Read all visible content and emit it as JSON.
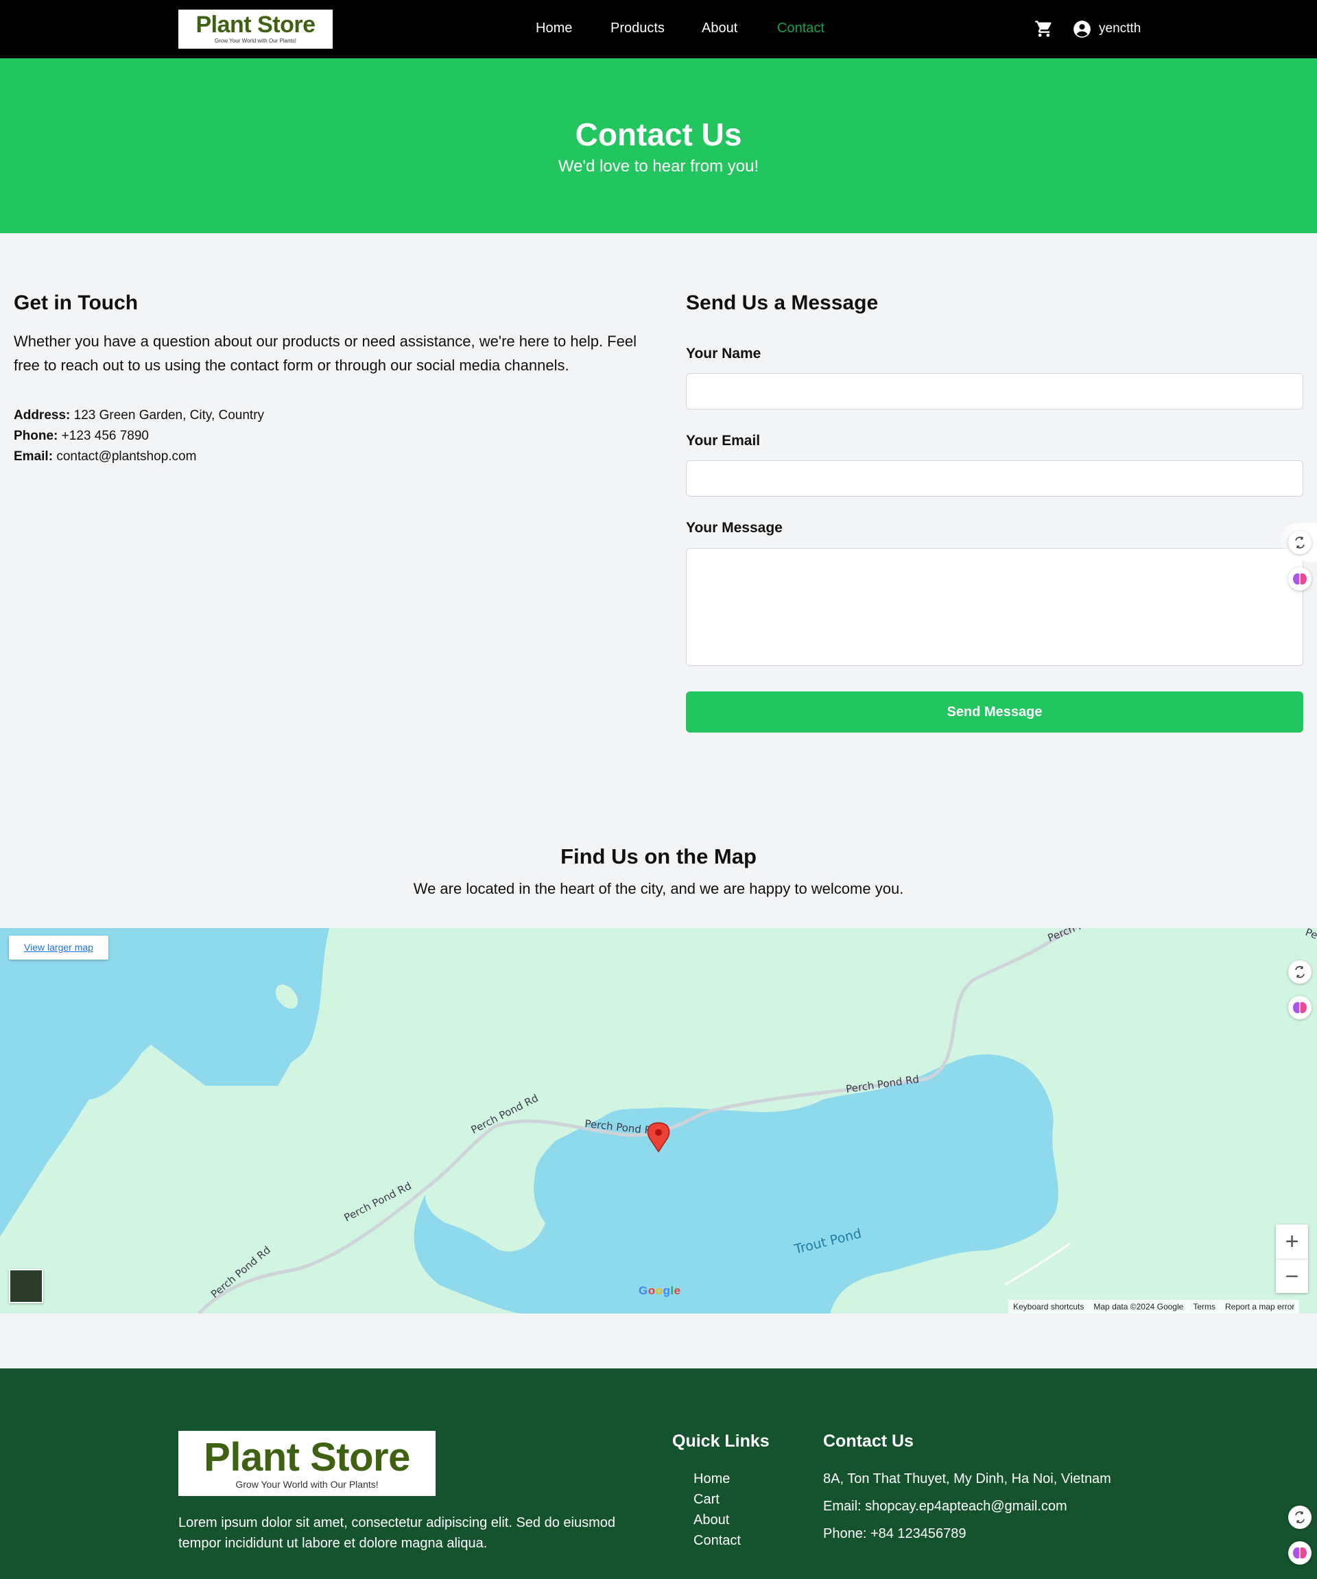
{
  "header": {
    "logo_title": "Plant Store",
    "logo_tagline": "Grow Your World with Our Plants!",
    "nav": [
      {
        "label": "Home"
      },
      {
        "label": "Products"
      },
      {
        "label": "About"
      },
      {
        "label": "Contact",
        "active": true
      }
    ],
    "username": "yenctth",
    "active_color": "#16a34a"
  },
  "hero": {
    "title": "Contact Us",
    "subtitle": "We'd love to hear from you!",
    "color": "#22c55e"
  },
  "touch": {
    "title": "Get in Touch",
    "text": "Whether you have a question about our products or need assistance, we're here to help. Feel free to reach out to us using the contact form or through our social media channels.",
    "address_label": "Address:",
    "address": "123 Green Garden, City, Country",
    "phone_label": "Phone:",
    "phone": "+123 456 7890",
    "email_label": "Email:",
    "email": "contact@plantshop.com"
  },
  "form": {
    "title": "Send Us a Message",
    "name_label": "Your Name",
    "name_value": "",
    "email_label": "Your Email",
    "email_value": "",
    "message_label": "Your Message",
    "message_value": "",
    "submit_label": "Send Message"
  },
  "map_section": {
    "title": "Find Us on the Map",
    "subtitle": "We are located in the heart of the city, and we are happy to welcome you.",
    "larger_map_link": "View larger map",
    "road_labels": [
      "Perch Pond Rd",
      "Perch Pond Rd",
      "Perch Pond Rd",
      "Perch Pond Rd",
      "Perch Pond Rd",
      "Perch P..",
      "Pe"
    ],
    "water_label": "Trout Pond",
    "google_logo": "Google",
    "attribution": [
      "Keyboard shortcuts",
      "Map data ©2024 Google",
      "Terms",
      "Report a map error"
    ],
    "zoom_in": "+",
    "zoom_out": "−"
  },
  "footer": {
    "logo_title": "Plant Store",
    "logo_tagline": "Grow Your World with Our Plants!",
    "description": "Lorem ipsum dolor sit amet, consectetur adipiscing elit. Sed do eiusmod tempor incididunt ut labore et dolore magna aliqua.",
    "quick_links_title": "Quick Links",
    "quick_links": [
      "Home",
      "Cart",
      "About",
      "Contact"
    ],
    "contact_title": "Contact Us",
    "contact_address": "8A, Ton That Thuyet, My Dinh, Ha Noi, Vietnam",
    "contact_email": "Email: shopcay.ep4apteach@gmail.com",
    "contact_phone": "Phone: +84 123456789"
  },
  "icons": {
    "cart": "cart-icon",
    "user": "user-circle-icon",
    "translate": "translate-icon",
    "brain": "brain-icon",
    "map_pin": "map-pin-icon"
  }
}
